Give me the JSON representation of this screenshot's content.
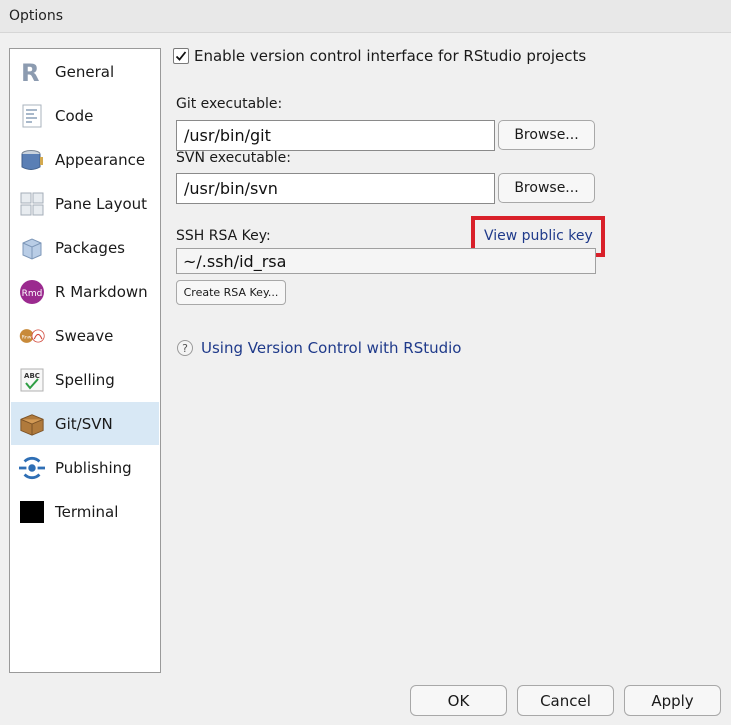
{
  "window": {
    "title": "Options"
  },
  "sidebar": {
    "items": [
      {
        "label": "General",
        "icon": "r-logo-icon"
      },
      {
        "label": "Code",
        "icon": "code-document-icon"
      },
      {
        "label": "Appearance",
        "icon": "paint-bucket-icon"
      },
      {
        "label": "Pane Layout",
        "icon": "pane-layout-icon"
      },
      {
        "label": "Packages",
        "icon": "package-box-icon"
      },
      {
        "label": "R Markdown",
        "icon": "rmd-icon"
      },
      {
        "label": "Sweave",
        "icon": "sweave-icon"
      },
      {
        "label": "Spelling",
        "icon": "spelling-abc-icon"
      },
      {
        "label": "Git/SVN",
        "icon": "git-box-icon",
        "selected": true
      },
      {
        "label": "Publishing",
        "icon": "publishing-icon"
      },
      {
        "label": "Terminal",
        "icon": "terminal-icon"
      }
    ]
  },
  "main": {
    "enable_vcs_label": "Enable version control interface for RStudio projects",
    "enable_vcs_checked": true,
    "git_label": "Git executable:",
    "git_value": "/usr/bin/git",
    "svn_label": "SVN executable:",
    "svn_value": "/usr/bin/svn",
    "browse_label": "Browse...",
    "ssh_label": "SSH RSA Key:",
    "view_key_link": "View public key",
    "ssh_value": "~/.ssh/id_rsa",
    "create_key_label": "Create RSA Key...",
    "help_link": "Using Version Control with RStudio"
  },
  "footer": {
    "ok": "OK",
    "cancel": "Cancel",
    "apply": "Apply"
  },
  "colors": {
    "accent": "#1f3a8a",
    "highlight": "#d9202a",
    "selected": "#d8e8f5"
  }
}
